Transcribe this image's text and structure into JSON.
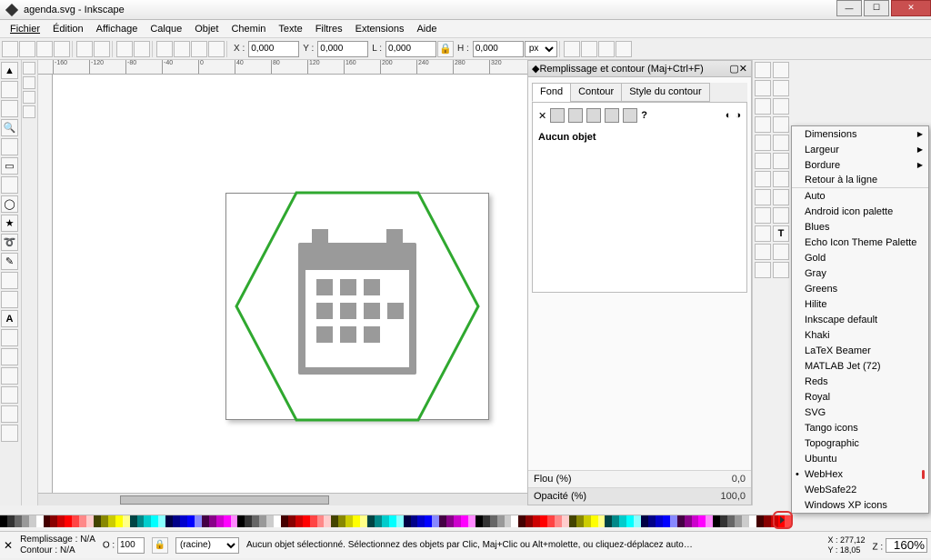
{
  "window": {
    "title": "agenda.svg - Inkscape"
  },
  "menu": [
    "Fichier",
    "Édition",
    "Affichage",
    "Calque",
    "Objet",
    "Chemin",
    "Texte",
    "Filtres",
    "Extensions",
    "Aide"
  ],
  "coordbar": {
    "x_label": "X :",
    "x_value": "0,000",
    "y_label": "Y :",
    "y_value": "0,000",
    "w_label": "L :",
    "w_value": "0,000",
    "h_label": "H :",
    "h_value": "0,000",
    "unit": "px"
  },
  "fillpanel": {
    "title": "Remplissage et contour (Maj+Ctrl+F)",
    "tabs": [
      "Fond",
      "Contour",
      "Style du contour"
    ],
    "none_label": "Aucun objet",
    "blur_label": "Flou (%)",
    "blur_value": "0,0",
    "opacity_label": "Opacité (%)",
    "opacity_value": "100,0"
  },
  "context_menu": {
    "sub_items": [
      "Dimensions",
      "Largeur",
      "Bordure"
    ],
    "return": "Retour à la ligne",
    "palettes": [
      "Auto",
      "Android icon palette",
      "Blues",
      "Echo Icon Theme Palette",
      "Gold",
      "Gray",
      "Greens",
      "Hilite",
      "Inkscape default",
      "Khaki",
      "LaTeX Beamer",
      "MATLAB Jet (72)",
      "Reds",
      "Royal",
      "SVG",
      "Tango icons",
      "Topographic",
      "Ubuntu",
      "WebHex",
      "WebSafe22",
      "Windows XP icons"
    ],
    "selected": "WebHex"
  },
  "status": {
    "fill_label": "Remplissage :",
    "fill_value": "N/A",
    "stroke_label": "Contour :",
    "stroke_value": "N/A",
    "opacity_label": "O :",
    "opacity_value": "100",
    "layer": "(racine)",
    "message": "Aucun objet sélectionné. Sélectionnez des objets par Clic, Maj+Clic ou Alt+molette, ou cliquez-déplacez auto…",
    "x_label": "X :",
    "x_value": "277,12",
    "y_label": "Y :",
    "y_value": "18,05",
    "z_label": "Z :",
    "zoom": "160%"
  },
  "ruler_ticks": [
    "-160",
    "-120",
    "-80",
    "-40",
    "0",
    "40",
    "80",
    "120",
    "160",
    "200",
    "240",
    "280",
    "320"
  ],
  "palette_colors": [
    "#000",
    "#333",
    "#666",
    "#999",
    "#ccc",
    "#fff",
    "#400",
    "#800",
    "#c00",
    "#f00",
    "#f44",
    "#f88",
    "#fcc",
    "#440",
    "#880",
    "#cc0",
    "#ff0",
    "#ff8",
    "#044",
    "#088",
    "#0cc",
    "#0ff",
    "#8ff",
    "#004",
    "#008",
    "#00c",
    "#00f",
    "#88f",
    "#404",
    "#808",
    "#c0c",
    "#f0f",
    "#f8f"
  ]
}
